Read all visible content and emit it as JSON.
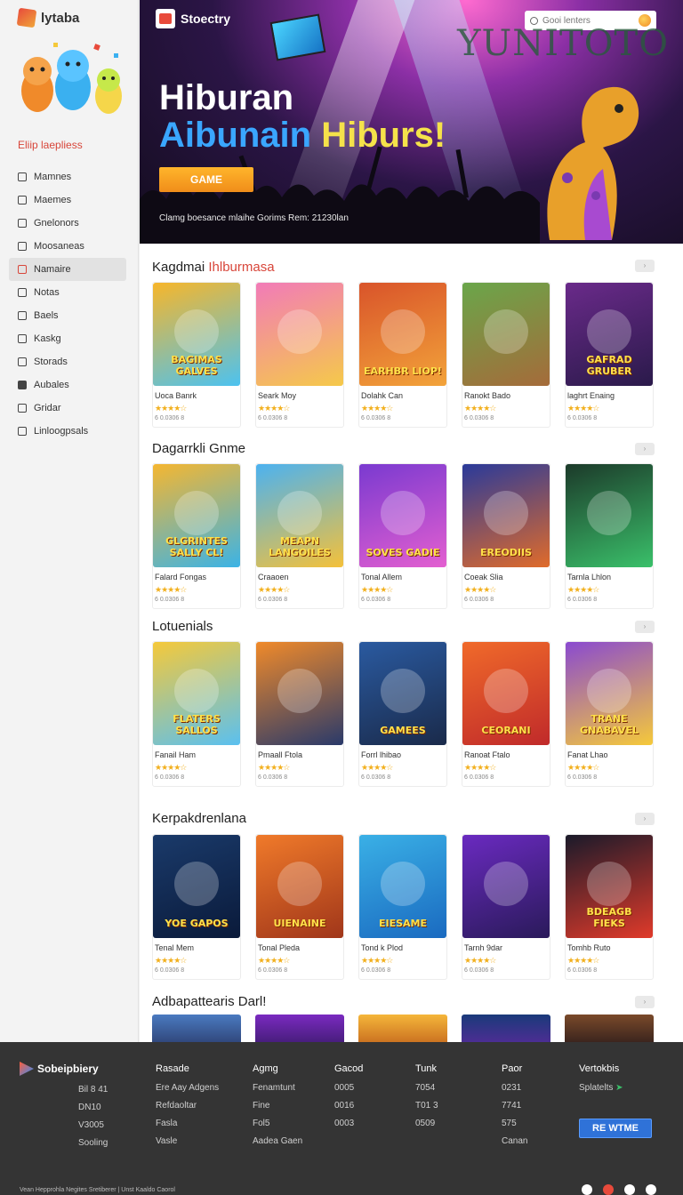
{
  "sidebar": {
    "brand": "lytaba",
    "heading": "Eliip laepliess",
    "items": [
      {
        "label": "Mamnes",
        "icon": "user-icon",
        "active": false
      },
      {
        "label": "Maemes",
        "icon": "user-icon",
        "active": false
      },
      {
        "label": "Gnelonors",
        "icon": "user-icon",
        "active": false
      },
      {
        "label": "Moosaneas",
        "icon": "box-icon",
        "active": false
      },
      {
        "label": "Namaire",
        "icon": "user-icon",
        "active": true
      },
      {
        "label": "Notas",
        "icon": "chat-icon",
        "active": false
      },
      {
        "label": "Baels",
        "icon": "box-icon",
        "active": false
      },
      {
        "label": "Kaskg",
        "icon": "box-icon",
        "active": false
      },
      {
        "label": "Storads",
        "icon": "box-icon",
        "active": false
      },
      {
        "label": "Aubales",
        "icon": "mail-icon",
        "active": false
      },
      {
        "label": "Gridar",
        "icon": "check-icon",
        "active": false
      },
      {
        "label": "Linloogpsals",
        "icon": "box-icon",
        "active": false
      }
    ]
  },
  "hero": {
    "brand": "Stoectry",
    "search_placeholder": "Gooi lenters",
    "watermark": "YUNITOTO",
    "title_line1": "Hiburan",
    "title_line2a": "Aibunain",
    "title_line2b": "Hiburs!",
    "cta": "GAME",
    "subtitle": "Clamg boesance mlaihe Gorims Rem: 21230lan"
  },
  "sections": [
    {
      "title": "Kagdmai",
      "title_highlight": "Ihlburmasa",
      "games": [
        {
          "thumb_text": "BAGIMAS GALVES",
          "title": "Uoca Banrk",
          "colors": [
            "#f7b62a",
            "#4cc2f0"
          ]
        },
        {
          "thumb_text": "",
          "title": "Seark Moy",
          "colors": [
            "#f27bb8",
            "#f5c94a"
          ]
        },
        {
          "thumb_text": "EARHBR LIOP!",
          "title": "Dolahk Can",
          "colors": [
            "#d9542a",
            "#f2a33a"
          ]
        },
        {
          "thumb_text": "",
          "title": "Ranokt Bado",
          "colors": [
            "#6aa64a",
            "#a56b3a"
          ]
        },
        {
          "thumb_text": "GAFRAD GRUBER",
          "title": "laghrt Enaing",
          "colors": [
            "#6a2a8a",
            "#2a1a4a"
          ]
        }
      ]
    },
    {
      "title": "Dagarrkli Gnme",
      "title_highlight": "",
      "games": [
        {
          "thumb_text": "GLGRINTES SALLY CL!",
          "title": "Falard Fongas",
          "colors": [
            "#f5b630",
            "#3bb3e6"
          ]
        },
        {
          "thumb_text": "MEAPN LANGOILES",
          "title": "Craaoen",
          "colors": [
            "#4cb2f0",
            "#f4c13a"
          ]
        },
        {
          "thumb_text": "SOVES GADIE",
          "title": "Tonal Allem",
          "colors": [
            "#7a3ad0",
            "#e35fd0"
          ]
        },
        {
          "thumb_text": "EREODIIS",
          "title": "Coeak Slia",
          "colors": [
            "#2a3a9a",
            "#e06b2a"
          ]
        },
        {
          "thumb_text": "",
          "title": "Tarnla Lhlon",
          "colors": [
            "#1c3a2a",
            "#3ac06a"
          ]
        }
      ]
    },
    {
      "title": "Lotuenials",
      "title_highlight": "",
      "games": [
        {
          "thumb_text": "FLATERS SALLOS",
          "title": "Fanail Ham",
          "colors": [
            "#f5c93a",
            "#5ac0f0"
          ]
        },
        {
          "thumb_text": "",
          "title": "Pmaall Ftola",
          "colors": [
            "#f08a2a",
            "#2a3a6a"
          ]
        },
        {
          "thumb_text": "GAMEES",
          "title": "Forrl lhibao",
          "colors": [
            "#2a5aa0",
            "#1a2a4a"
          ]
        },
        {
          "thumb_text": "CEORANI",
          "title": "Ranoat Ftalo",
          "colors": [
            "#f06a2a",
            "#c02a2a"
          ]
        },
        {
          "thumb_text": "TRANE GNABAVEL",
          "title": "Fanat Lhao",
          "colors": [
            "#8a4ad0",
            "#f5c93a"
          ]
        }
      ]
    },
    {
      "title": "Kerpakdrenlana",
      "title_highlight": "",
      "games": [
        {
          "thumb_text": "YOE GAPOS",
          "title": "Tenal Mem",
          "colors": [
            "#1a3a6a",
            "#0a1a3a"
          ]
        },
        {
          "thumb_text": "UIENAINE",
          "title": "Tonal Pleda",
          "colors": [
            "#f07a2a",
            "#a0361a"
          ]
        },
        {
          "thumb_text": "EIESAME",
          "title": "Tond k Plod",
          "colors": [
            "#3ab0e6",
            "#1a6ac0"
          ]
        },
        {
          "thumb_text": "",
          "title": "Tarnh 9dar",
          "colors": [
            "#6a2ac0",
            "#2a1a5a"
          ]
        },
        {
          "thumb_text": "BDEAGB FIEKS",
          "title": "Tomhb Ruto",
          "colors": [
            "#1a1a2a",
            "#e03a2a"
          ]
        }
      ]
    }
  ],
  "card_rating": "★★★★☆",
  "card_meta": "6 0.0306  8",
  "next_section": {
    "title": "Adbapattearis",
    "title_suffix": "Darl!"
  },
  "footer": {
    "brand": "Sobeipbiery",
    "columns": [
      {
        "heading": "",
        "items": [
          "Bil 8 41",
          "DN10",
          "V3005",
          "Sooling"
        ]
      },
      {
        "heading": "Rasade",
        "items": [
          "Ere Aay Adgens",
          "Refdaoltar",
          "Fasla",
          "Vasle"
        ]
      },
      {
        "heading": "Agmg",
        "items": [
          "Fenamtunt",
          "Fine",
          "Fol5",
          "Aadea Gaen"
        ]
      },
      {
        "heading": "Gacod",
        "items": [
          "0005",
          "0016",
          "0003",
          ""
        ]
      },
      {
        "heading": "Tunk",
        "items": [
          "7054",
          "T01 3",
          "0509",
          ""
        ]
      },
      {
        "heading": "Paor",
        "items": [
          "0231",
          "7741",
          "575",
          "Canan"
        ]
      },
      {
        "heading": "Vertokbis",
        "items": [
          "Splatelts",
          "",
          "",
          ""
        ]
      }
    ],
    "cta": "RE WTME",
    "legal": "Vean Hepprohla Negites Sretiberer | Unst Kaaldo Caorol"
  }
}
